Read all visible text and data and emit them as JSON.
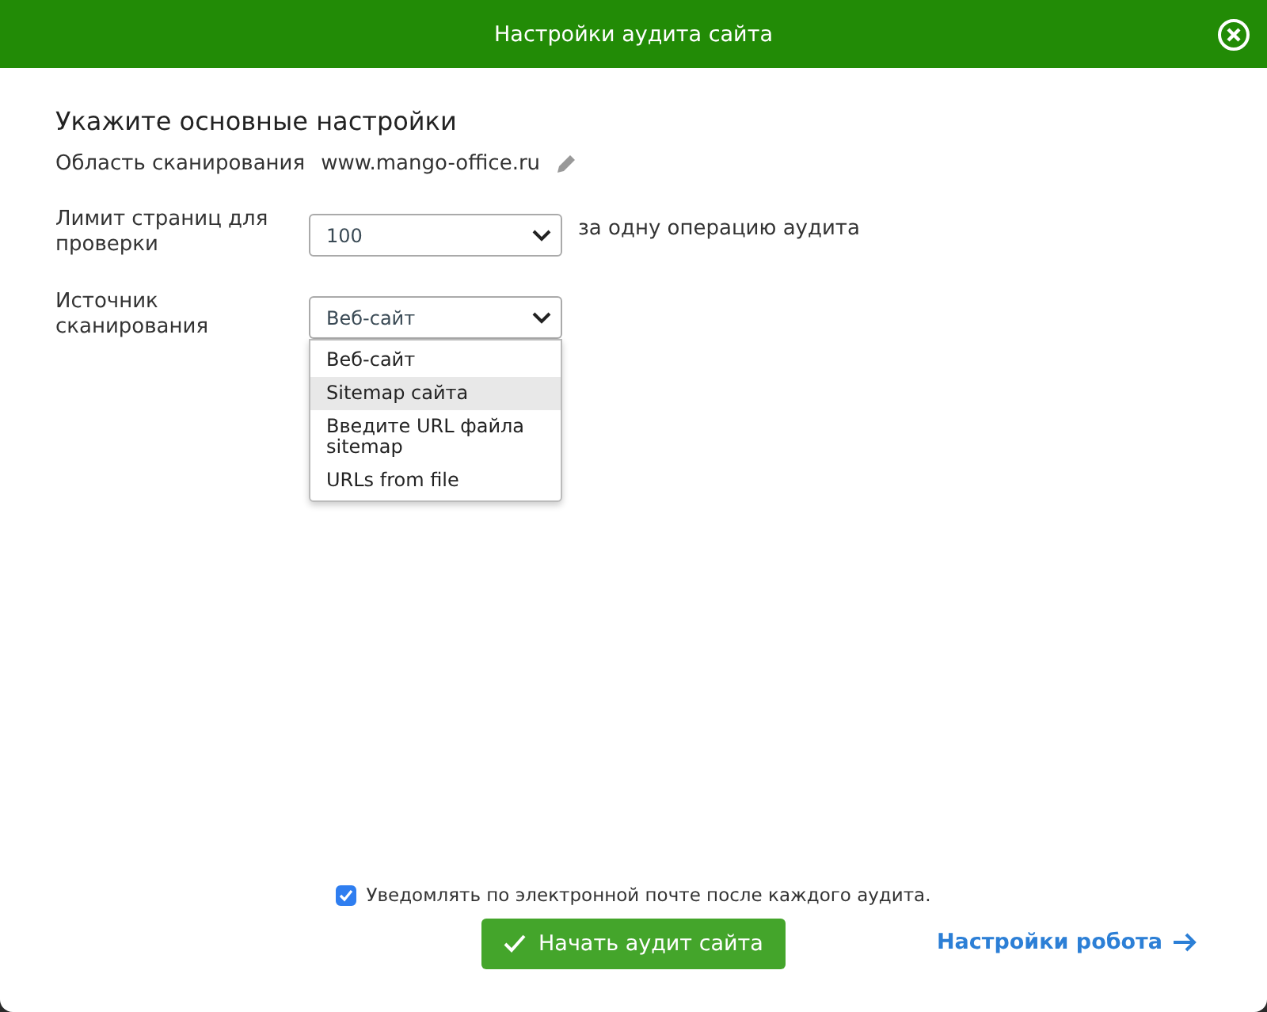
{
  "window": {
    "title": "Настройки аудита сайта"
  },
  "heading": "Укажите основные настройки",
  "scan_area": {
    "label": "Область сканирования",
    "value": "www.mango-office.ru"
  },
  "page_limit": {
    "label": "Лимит страниц для проверки",
    "value": "100",
    "suffix": "за одну операцию аудита"
  },
  "scan_source": {
    "label": "Источник сканирования",
    "value": "Веб-сайт",
    "expanded": true,
    "options": [
      {
        "label": "Веб-сайт",
        "highlighted": false
      },
      {
        "label": "Sitemap сайта",
        "highlighted": true
      },
      {
        "label": "Введите URL файла sitemap",
        "highlighted": false
      },
      {
        "label": "URLs from file",
        "highlighted": false
      }
    ]
  },
  "notify": {
    "label": "Уведомлять по электронной почте после каждого аудита.",
    "checked": true
  },
  "start_button": "Начать аудит сайта",
  "robot_link": "Настройки робота"
}
